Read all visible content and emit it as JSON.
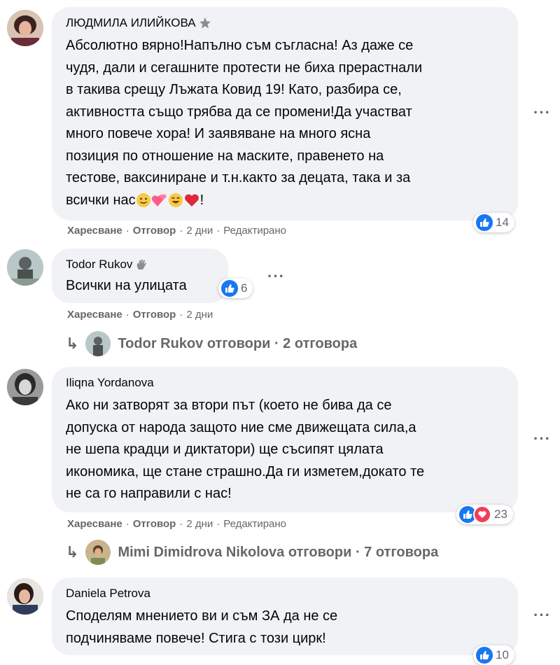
{
  "comments": [
    {
      "author": "ЛЮДМИЛА ИЛИЙКОВА",
      "lines": [
        "Абсолютно вярно!Напълно съм съгласна! Аз даже се",
        "чудя, дали и сегашните протести не биха прерастнали",
        "в такива срещу Лъжата Ковид 19! Като, разбира се,",
        "активността също трябва да се промени!Да участват",
        "много повече хора! И заявяване на много ясна",
        "позиция по отношение на маските, правенето на",
        "тестове, ваксиниране и т.н.както за децата, така и за",
        "всички нас",
        "!"
      ],
      "badge_icon": "star-badge-icon",
      "reaction_count": "14",
      "like_label": "Харесване",
      "reply_label": "Отговор",
      "time": "2 дни",
      "edited": "Редактирано"
    },
    {
      "author": "Todor Rukov",
      "text": "Всички на улицата",
      "badge_icon": "wave-badge-icon",
      "reaction_count": "6",
      "like_label": "Харесване",
      "reply_label": "Отговор",
      "time": "2 дни",
      "replies_text": "Todor Rukov отговори · 2 отговора"
    },
    {
      "author": "Iliqna Yordanova",
      "lines": [
        "Ако ни затворят за втори път (което не бива да се",
        "допуска от народа защото ние сме движещата сила,а",
        "не шепа крадци и диктатори) ще съсипят цялата",
        "икономика, ще стане страшно.Да ги изметем,докато те",
        "не са го направили с нас!"
      ],
      "reaction_count": "23",
      "like_label": "Харесване",
      "reply_label": "Отговор",
      "time": "2 дни",
      "edited": "Редактирано",
      "replies_text": "Mimi Dimidrova Nikolova отговори · 7 отговора"
    },
    {
      "author": "Daniela Petrova",
      "lines": [
        "Споделям мнението ви и съм ЗА да не се",
        "подчиняваме повече! Стига с този цирк!"
      ],
      "reaction_count": "10"
    }
  ],
  "more_icon": "more-options-icon",
  "colors": {
    "bubble": "#f0f2f5",
    "meta": "#65676b",
    "like": "#1877f2",
    "love": "#f33e58"
  }
}
